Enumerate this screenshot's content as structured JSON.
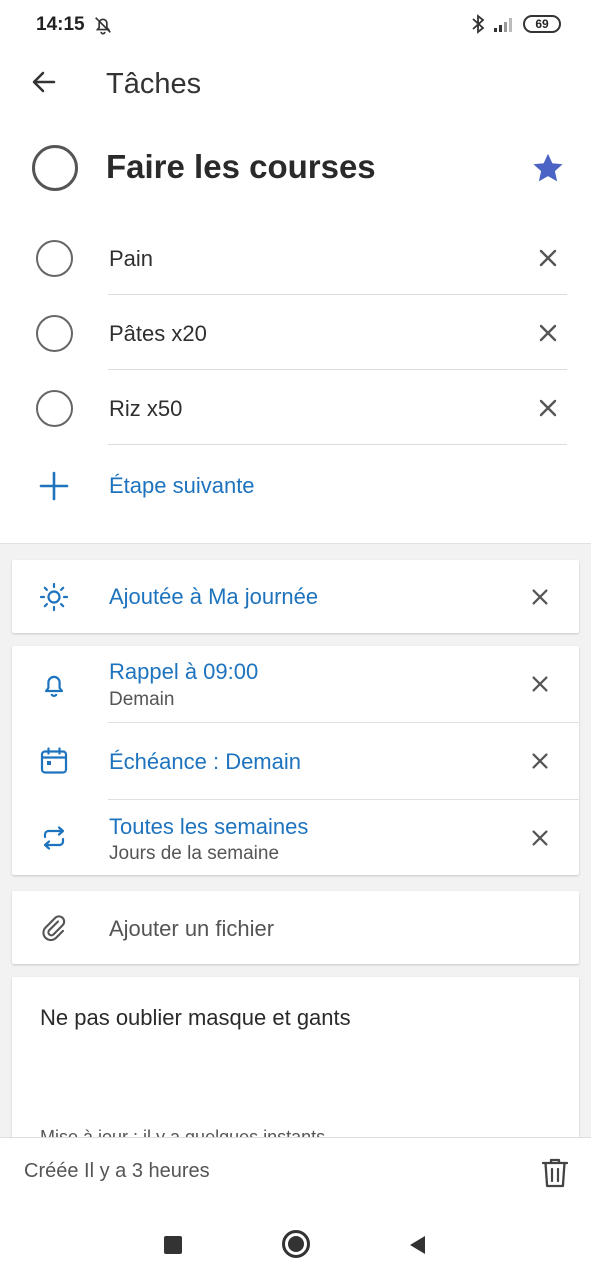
{
  "status_bar": {
    "time": "14:15",
    "battery": "69",
    "icons": [
      "bell-off-icon",
      "bluetooth-icon",
      "signal-icon",
      "battery-icon"
    ]
  },
  "header": {
    "title": "Tâches"
  },
  "task": {
    "title": "Faire les courses",
    "important": true
  },
  "steps": [
    {
      "label": "Pain"
    },
    {
      "label": "Pâtes x20"
    },
    {
      "label": "Riz x50"
    }
  ],
  "next_step_label": "Étape suivante",
  "my_day": {
    "label": "Ajoutée à Ma journée"
  },
  "reminder": {
    "label": "Rappel à 09:00",
    "sub": "Demain"
  },
  "due": {
    "label": "Échéance : Demain"
  },
  "repeat": {
    "label": "Toutes les semaines",
    "sub": "Jours de la semaine"
  },
  "attach": {
    "label": "Ajouter un fichier"
  },
  "note": {
    "text": "Ne pas oublier masque et gants",
    "updated": "Mise à jour : il y a quelques instants"
  },
  "footer": {
    "created": "Créée Il y a 3 heures"
  },
  "colors": {
    "accent": "#1e73be",
    "star": "#4a63c4"
  }
}
